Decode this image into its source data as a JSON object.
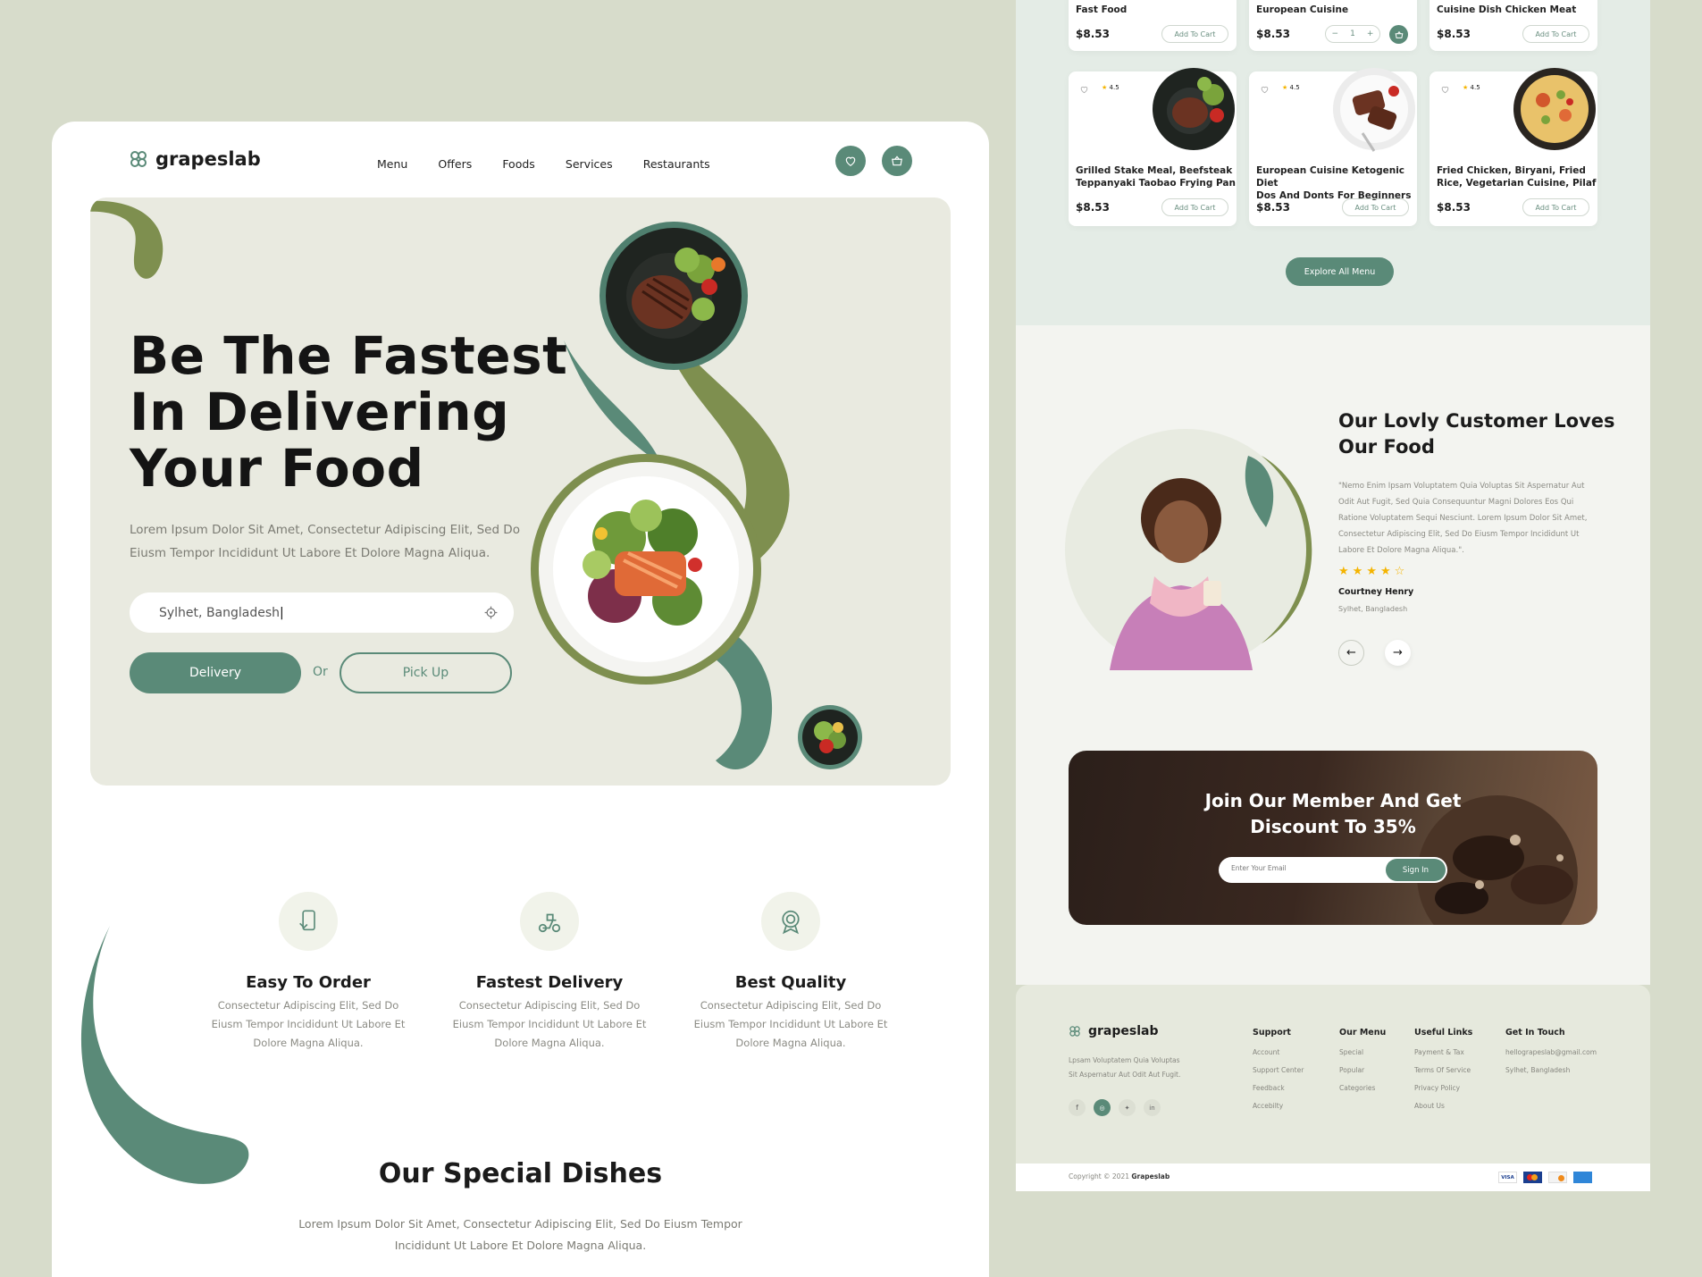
{
  "brand": {
    "name": "grapeslab"
  },
  "nav": {
    "items": [
      "Menu",
      "Offers",
      "Foods",
      "Services",
      "Restaurants"
    ]
  },
  "hero": {
    "title_line1": "Be The Fastest",
    "title_line2": "In Delivering",
    "title_line3": "Your Food",
    "subtitle_line1": "Lorem Ipsum Dolor Sit Amet, Consectetur Adipiscing Elit, Sed Do",
    "subtitle_line2": "Eiusm Tempor Incididunt Ut Labore Et Dolore Magna Aliqua.",
    "location_value": "Sylhet, Bangladesh",
    "delivery_label": "Delivery",
    "or_label": "Or",
    "pickup_label": "Pick Up"
  },
  "features": [
    {
      "title": "Easy To Order",
      "desc1": "Consectetur Adipiscing Elit, Sed Do",
      "desc2": "Eiusm Tempor Incididunt Ut Labore Et",
      "desc3": "Dolore Magna Aliqua."
    },
    {
      "title": "Fastest Delivery",
      "desc1": "Consectetur Adipiscing Elit, Sed Do",
      "desc2": "Eiusm Tempor Incididunt Ut Labore Et",
      "desc3": "Dolore Magna Aliqua."
    },
    {
      "title": "Best Quality",
      "desc1": "Consectetur Adipiscing Elit, Sed Do",
      "desc2": "Eiusm Tempor Incididunt Ut Labore Et",
      "desc3": "Dolore Magna Aliqua."
    }
  ],
  "special": {
    "title": "Our Special Dishes",
    "desc1": "Lorem Ipsum Dolor Sit Amet, Consectetur Adipiscing Elit, Sed Do Eiusm Tempor",
    "desc2": "Incididunt Ut Labore Et Dolore Magna Aliqua."
  },
  "menu_top": [
    {
      "name": "Fast Food",
      "price": "$8.53",
      "cart": "Add To Cart"
    },
    {
      "name": "European Cuisine",
      "price": "$8.53",
      "qty": "1"
    },
    {
      "name": "Cuisine Dish Chicken Meat",
      "price": "$8.53",
      "cart": "Add To Cart"
    }
  ],
  "menu_cards": [
    {
      "rating": "4.5",
      "name1": "Grilled Stake Meal, Beefsteak",
      "name2": "Teppanyaki Taobao Frying Pan",
      "price": "$8.53",
      "cart": "Add To Cart"
    },
    {
      "rating": "4.5",
      "name1": "European Cuisine Ketogenic Diet",
      "name2": "Dos And Donts For Beginners",
      "price": "$8.53",
      "cart": "Add To Cart"
    },
    {
      "rating": "4.5",
      "name1": "Fried Chicken, Biryani, Fried",
      "name2": "Rice, Vegetarian Cuisine, Pilaf",
      "price": "$8.53",
      "cart": "Add To Cart"
    }
  ],
  "explore": {
    "label": "Explore All Menu"
  },
  "testimonial": {
    "title_line1": "Our  Lovly Customer Loves",
    "title_line2": "Our Food",
    "quote_line1": "\"Nemo Enim Ipsam Voluptatem Quia Voluptas Sit Aspernatur Aut",
    "quote_line2": "Odit Aut Fugit, Sed Quia Consequuntur Magni Dolores Eos Qui",
    "quote_line3": "Ratione Voluptatem Sequi Nesciunt. Lorem Ipsum Dolor Sit Amet,",
    "quote_line4": "Consectetur Adipiscing Elit, Sed Do Eiusm Tempor Incididunt Ut",
    "quote_line5": "Labore Et Dolore Magna Aliqua.\".",
    "rating": 4,
    "rating_max": 5,
    "name": "Courtney Henry",
    "location": "Sylhet, Bangladesh"
  },
  "newsletter": {
    "title_line1": "Join Our Member And Get",
    "title_line2": "Discount To 35%",
    "placeholder": "Enter Your Email",
    "button": "Sign In"
  },
  "footer": {
    "brand": "grapeslab",
    "desc1": "Lpsam Voluptatem Quia Voluptas",
    "desc2": "Sit Aspernatur Aut Odit Aut Fugit.",
    "columns": [
      {
        "title": "Support",
        "items": [
          "Account",
          "Support Center",
          "Feedback",
          "Accebilty"
        ]
      },
      {
        "title": "Our Menu",
        "items": [
          "Special",
          "Popular",
          "Categories"
        ]
      },
      {
        "title": "Useful Links",
        "items": [
          "Payment & Tax",
          "Terms Of Service",
          "Privacy Policy",
          "About Us"
        ]
      },
      {
        "title": "Get In Touch",
        "items": [
          "hellograpeslab@gmail.com",
          "Sylhet, Bangladesh"
        ]
      }
    ],
    "social": [
      "f",
      "ig",
      "tw",
      "in"
    ],
    "copyright_prefix": "Copyright © 2021 ",
    "copyright_brand": "Grapeslab",
    "payments": [
      "VISA",
      "MC",
      "DISC",
      "AMEX"
    ]
  },
  "colors": {
    "accent": "#5a8a78",
    "olive": "#7e8f4f",
    "bg": "#d7dccb",
    "hero_bg": "#e9eae0"
  }
}
